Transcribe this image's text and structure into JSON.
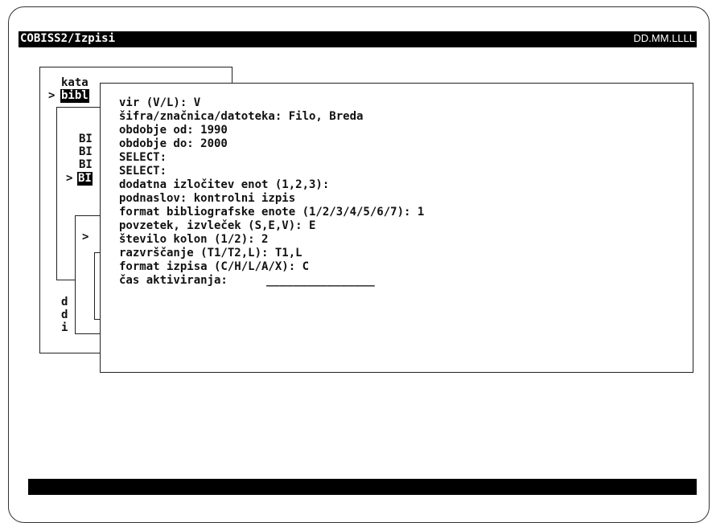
{
  "window": {
    "title": "COBISS2/Izpisi",
    "date": "DD.MM.LLLL"
  },
  "menu": {
    "level1": [
      "kata",
      "bibl",
      "d",
      "d",
      "i"
    ],
    "marker": ">",
    "level2": [
      "BI",
      "BI",
      "BI",
      "BI"
    ],
    "level3_marker": ">"
  },
  "dialog": {
    "rows": [
      "vir (V/L): V",
      "šifra/značnica/datoteka: Filo, Breda",
      "obdobje od: 1990",
      "obdobje do: 2000",
      "SELECT:",
      "SELECT:",
      "dodatna izločitev enot (1,2,3):",
      "podnaslov: kontrolni izpis",
      "format bibliografske enote (1/2/3/4/5/6/7): 1",
      "povzetek, izvleček (S,E,V): E",
      "število kolon (1/2): 2",
      "razvrščanje (T1/T2,L): T1,L",
      "format izpisa (C/H/L/A/X): C"
    ],
    "time_label": "čas aktiviranja:",
    "time_value": "________________"
  }
}
